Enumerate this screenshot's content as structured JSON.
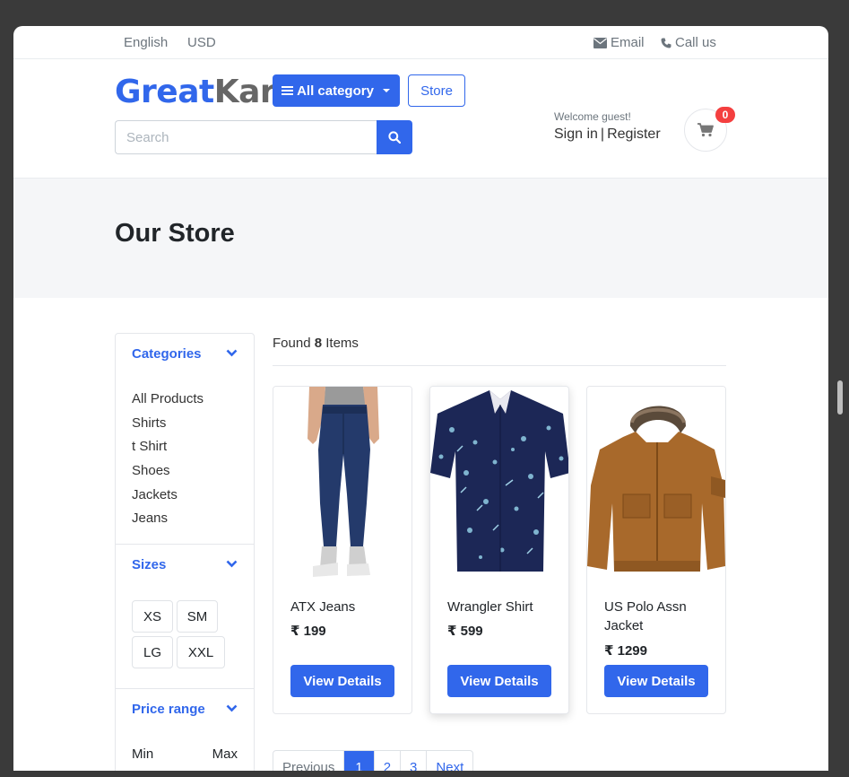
{
  "topbar": {
    "language": "English",
    "currency": "USD",
    "email": "Email",
    "call": "Call us"
  },
  "header": {
    "logo_part1": "Great",
    "logo_part2": "Kart",
    "all_category": "All category",
    "store": "Store",
    "search_placeholder": "Search",
    "welcome": "Welcome guest!",
    "sign_in": "Sign in",
    "separator": "|",
    "register": "Register",
    "cart_count": "0"
  },
  "page": {
    "title": "Our Store"
  },
  "sidebar": {
    "categories_title": "Categories",
    "categories": [
      "All Products",
      "Shirts",
      "t Shirt",
      "Shoes",
      "Jackets",
      "Jeans"
    ],
    "sizes_title": "Sizes",
    "sizes": [
      "XS",
      "SM",
      "LG",
      "XXL"
    ],
    "price_title": "Price range",
    "min_label": "Min",
    "max_label": "Max"
  },
  "results": {
    "found_prefix": "Found",
    "count": "8",
    "found_suffix": "Items"
  },
  "products": [
    {
      "name": "ATX Jeans",
      "price": "₹ 199",
      "button": "View Details"
    },
    {
      "name": "Wrangler Shirt",
      "price": "₹ 599",
      "button": "View Details"
    },
    {
      "name": "US Polo Assn Jacket",
      "price": "₹ 1299",
      "button": "View Details"
    }
  ],
  "pagination": {
    "previous": "Previous",
    "pages": [
      "1",
      "2",
      "3"
    ],
    "next": "Next",
    "active_page": "1"
  },
  "colors": {
    "primary": "#3167eb",
    "badge": "#f43f3f",
    "band": "#f5f6f8"
  }
}
